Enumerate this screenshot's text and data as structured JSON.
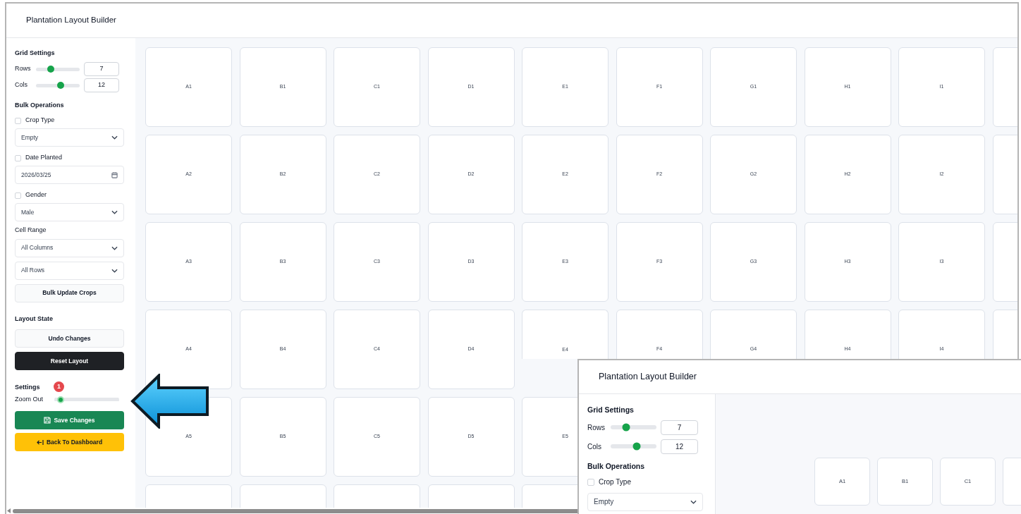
{
  "window": {
    "title": "Plantation Layout Builder"
  },
  "grid_settings": {
    "heading": "Grid Settings",
    "sliders": [
      {
        "label": "Rows",
        "level": 0.34,
        "value": "7"
      },
      {
        "label": "Cols",
        "level": 0.56,
        "value": "12"
      }
    ]
  },
  "bulk_operations": {
    "heading": "Bulk Operations",
    "fields": [
      {
        "kind": "select",
        "label": "Crop Type",
        "checked": false,
        "value": "Empty"
      },
      {
        "kind": "date",
        "label": "Date Planted",
        "checked": false,
        "value": "2026/03/25"
      },
      {
        "kind": "select",
        "label": "Gender",
        "checked": false,
        "value": "Male"
      }
    ],
    "cell_range": {
      "label": "Cell Range",
      "selects": [
        "All Columns",
        "All Rows"
      ]
    },
    "button": "Bulk Update Crops"
  },
  "layout_state": {
    "heading": "Layout State",
    "buttons": [
      {
        "label": "Undo Changes",
        "kind": "secondary"
      },
      {
        "label": "Reset Layout",
        "kind": "dark"
      }
    ]
  },
  "settings": {
    "heading": "Settings",
    "badge": "1",
    "zoom": {
      "label": "Zoom Out",
      "level": 0.05
    }
  },
  "actions": [
    {
      "label": "Save Changes",
      "kind": "save"
    },
    {
      "label": "Back To Dashboard",
      "kind": "back"
    }
  ],
  "grid": {
    "rows": [
      [
        "A1",
        "B1",
        "C1",
        "D1",
        "E1",
        "F1",
        "G1",
        "H1",
        "I1"
      ],
      [
        "A2",
        "B2",
        "C2",
        "D2",
        "E2",
        "F2",
        "G2",
        "H2",
        "I2"
      ],
      [
        "A3",
        "B3",
        "C3",
        "D3",
        "E3",
        "F3",
        "G3",
        "H3",
        "I3"
      ],
      [
        "A4",
        "B4",
        "C4",
        "D4",
        "E4",
        "F4",
        "G4",
        "H4",
        "I4"
      ],
      [
        "A5",
        "B5",
        "C5",
        "D5",
        "E5"
      ]
    ]
  },
  "inset_window": {
    "title": "Plantation Layout Builder",
    "grid_settings": {
      "heading": "Grid Settings",
      "sliders": [
        {
          "label": "Rows",
          "level": 0.34,
          "value": "7"
        },
        {
          "label": "Cols",
          "level": 0.57,
          "value": "12"
        }
      ]
    },
    "bulk_operations": {
      "heading": "Bulk Operations",
      "crop_type": {
        "label": "Crop Type",
        "checked": false
      },
      "select": "Empty"
    },
    "cells": [
      "A1",
      "B1",
      "C1"
    ]
  }
}
